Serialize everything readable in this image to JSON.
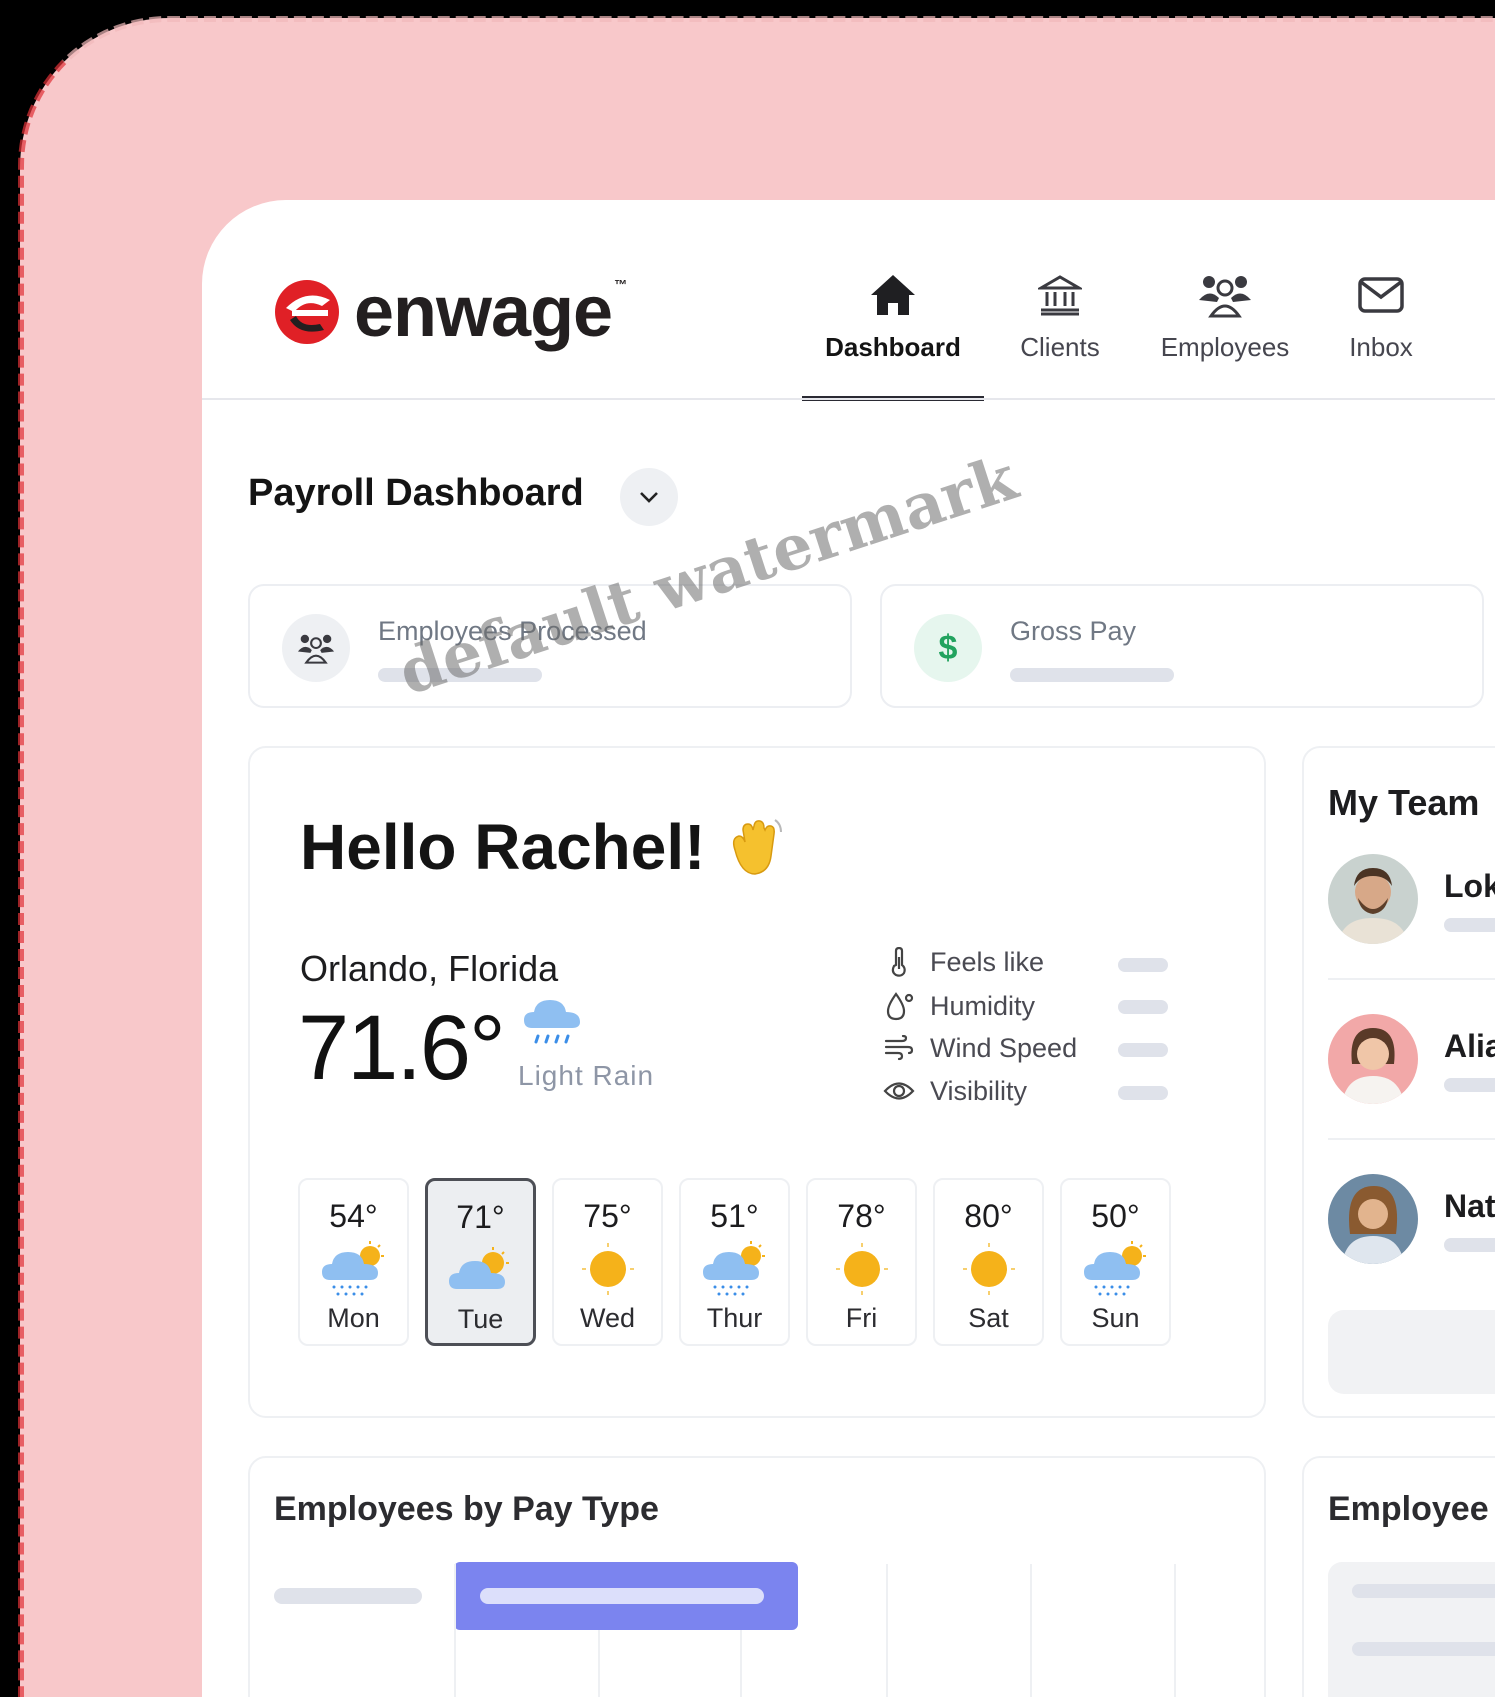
{
  "brand": {
    "name": "enwage",
    "trademark": "™",
    "color": "#e02026"
  },
  "nav": [
    {
      "label": "Dashboard",
      "icon": "home-icon",
      "active": true
    },
    {
      "label": "Clients",
      "icon": "bank-icon",
      "active": false
    },
    {
      "label": "Employees",
      "icon": "people-icon",
      "active": false
    },
    {
      "label": "Inbox",
      "icon": "mail-icon",
      "active": false
    }
  ],
  "page": {
    "title": "Payroll Dashboard"
  },
  "stats": [
    {
      "label": "Employees Processed",
      "icon": "people-icon"
    },
    {
      "label": "Gross Pay",
      "icon": "dollar-icon"
    }
  ],
  "weather": {
    "greeting": "Hello Rachel!",
    "greeting_emoji": "waving-hand-icon",
    "location": "Orlando, Florida",
    "temperature": "71.6°",
    "condition": "Light Rain",
    "metrics": [
      {
        "label": "Feels like",
        "icon": "thermometer-icon"
      },
      {
        "label": "Humidity",
        "icon": "droplet-icon"
      },
      {
        "label": "Wind Speed",
        "icon": "wind-icon"
      },
      {
        "label": "Visibility",
        "icon": "eye-icon"
      }
    ],
    "forecast": [
      {
        "temp": "54°",
        "day": "Mon",
        "icon": "rain-sun-icon",
        "selected": false
      },
      {
        "temp": "71°",
        "day": "Tue",
        "icon": "cloud-sun-icon",
        "selected": true
      },
      {
        "temp": "75°",
        "day": "Wed",
        "icon": "sun-icon",
        "selected": false
      },
      {
        "temp": "51°",
        "day": "Thur",
        "icon": "rain-sun-icon",
        "selected": false
      },
      {
        "temp": "78°",
        "day": "Fri",
        "icon": "sun-icon",
        "selected": false
      },
      {
        "temp": "80°",
        "day": "Sat",
        "icon": "sun-icon",
        "selected": false
      },
      {
        "temp": "50°",
        "day": "Sun",
        "icon": "rain-sun-icon",
        "selected": false
      }
    ]
  },
  "team": {
    "title": "My Team",
    "members": [
      {
        "name": "Lok"
      },
      {
        "name": "Alia"
      },
      {
        "name": "Nat"
      }
    ]
  },
  "sections": {
    "pay_type_title": "Employees by Pay Type",
    "employees_title": "Employee"
  },
  "watermark": "default watermark",
  "colors": {
    "accent_bar": "#7b84ef",
    "skeleton": "#dfe2ea",
    "sun": "#f5b21a",
    "cloud": "#8fbff1"
  }
}
